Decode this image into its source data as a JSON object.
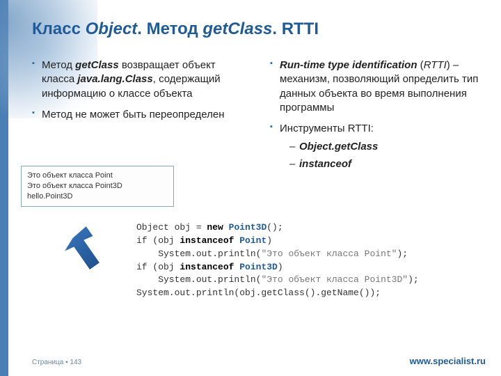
{
  "title": {
    "pre": "Класс ",
    "obj": "Object",
    "mid": ". Метод ",
    "method": "getClass",
    "post": ". RTTI"
  },
  "left_col": {
    "item1": {
      "pre": "Метод ",
      "m": "getClass",
      "mid": " возвращает объект класса ",
      "cls": "java.lang.Class",
      "post": ", содержащий  информацию о классе объекта"
    },
    "item2": "Метод не может быть переопределен"
  },
  "right_col": {
    "item1": {
      "t": "Run-time type identification",
      "abbr_pre": " (",
      "abbr": "RTTI",
      "post": ") – механизм, позволяющий определить тип данных объекта во время выполнения программы"
    },
    "item2": "Инструменты RTTI:",
    "sub1": "Object.getClass",
    "sub2": "instanceof"
  },
  "output": {
    "l1": "Это объект класса  Point",
    "l2": "Это объект класса  Point3D",
    "l3": "hello.Point3D"
  },
  "code": {
    "l1a": "Object obj = ",
    "l1b": "new",
    "l1c": " ",
    "l1d": "Point3D",
    "l1e": "();",
    "l2a": "if (obj ",
    "l2b": "instanceof",
    "l2c": " ",
    "l2d": "Point",
    "l2e": ")",
    "l3a": "    System.out.println(",
    "l3b": "\"Это объект класса Point\"",
    "l3c": ");",
    "l4a": "if (obj ",
    "l4b": "instanceof",
    "l4c": " ",
    "l4d": "Point3D",
    "l4e": ")",
    "l5a": "    System.out.println(",
    "l5b": "\"Это объект класса Point3D\"",
    "l5c": ");",
    "l6": "System.out.println(obj.getClass().getName());"
  },
  "footer": {
    "page_label": "Страница ▪ ",
    "page_num": "143",
    "site": "www.specialist.ru"
  }
}
